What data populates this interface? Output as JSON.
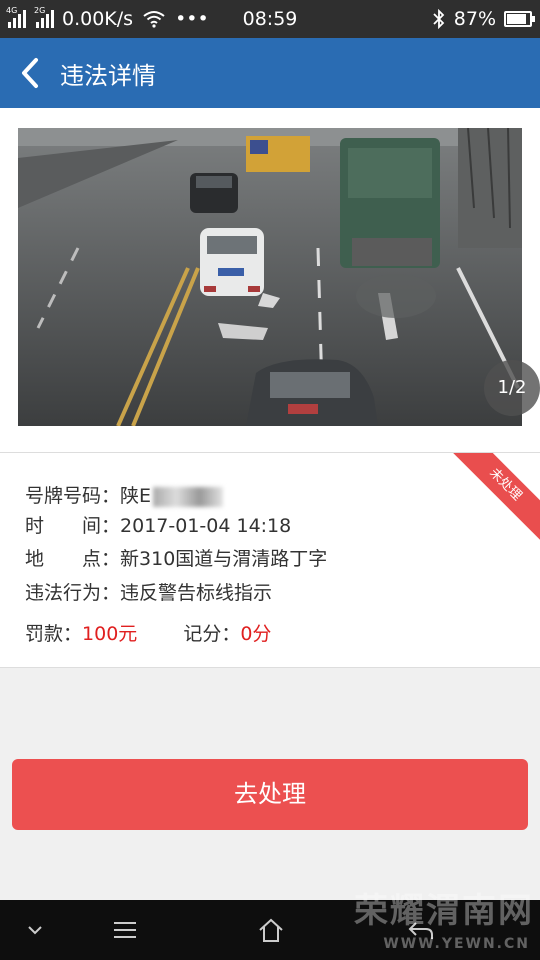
{
  "status": {
    "network_speed": "0.00K/s",
    "time": "08:59",
    "battery_text": "87%",
    "battery_level": 0.87,
    "signal_tag_1": "4G",
    "signal_tag_2": "2G",
    "more": "•••"
  },
  "header": {
    "title": "违法详情"
  },
  "photo": {
    "pager": "1/2"
  },
  "violation": {
    "ribbon": "未处理",
    "plate_label": "号牌号码：",
    "plate_value": "陕E",
    "time_label": "时　　间：",
    "time_value": "2017-01-04 14:18",
    "location_label": "地　　点：",
    "location_value": "新310国道与渭清路丁字",
    "behavior_label": "违法行为：",
    "behavior_value": "违反警告标线指示",
    "fine_label": "罚款：",
    "fine_value": "100元",
    "points_label": "记分：",
    "points_value": "0分"
  },
  "action": {
    "label": "去处理"
  },
  "watermark": {
    "main": "荣耀渭南网",
    "sub": "WWW.YEWN.CN"
  },
  "colors": {
    "header": "#2a6cb3",
    "action": "#ec5050",
    "accent_red": "#e02020"
  }
}
